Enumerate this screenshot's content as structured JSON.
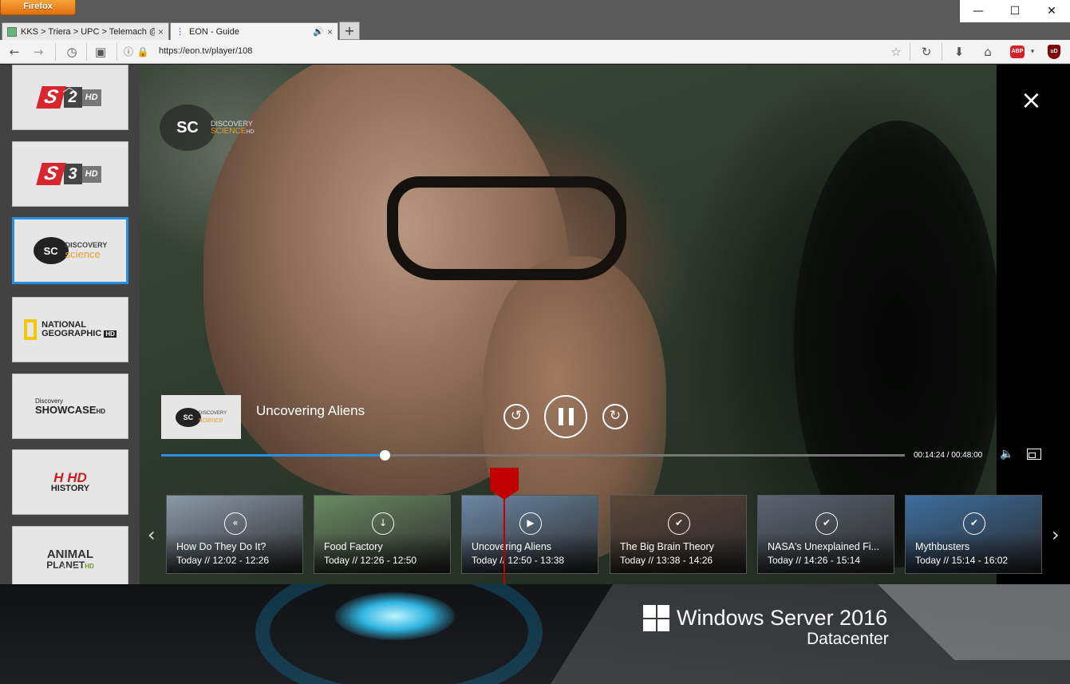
{
  "browser": {
    "app_button": "Firefox",
    "window_controls": {
      "minimize": "—",
      "maximize": "☐",
      "close": "✕"
    },
    "tabs": [
      {
        "label": "KKS > Triera > UPC > Telemach @ ...",
        "close": "×"
      },
      {
        "label": "EON - Guide",
        "sound": "🔊",
        "close": "×"
      }
    ],
    "new_tab": "+",
    "url": "https://eon.tv/player/108",
    "addons": {
      "adblock": "ABP",
      "ublock": "uD"
    }
  },
  "sidebar": {
    "channels": [
      {
        "name": "S2",
        "label_num": "2",
        "label_hd": "HD"
      },
      {
        "name": "S3",
        "label_num": "3",
        "label_hd": "HD"
      },
      {
        "name": "Discovery Science",
        "label_top": "DISCOVERY",
        "label_bottom": "science"
      },
      {
        "name": "National Geographic HD",
        "label_top": "NATIONAL",
        "label_bottom": "GEOGRAPHIC",
        "label_hd": "HD"
      },
      {
        "name": "Discovery Showcase HD",
        "label_top": "Discovery",
        "label_bottom": "SHOWCASE",
        "label_hd": "HD"
      },
      {
        "name": "History HD",
        "label_top": "H HD",
        "label_bottom": "HISTORY"
      },
      {
        "name": "Animal Planet HD",
        "label_top": "ANIMAL",
        "label_bottom": "PLANET",
        "label_hd": "HD"
      }
    ]
  },
  "player": {
    "watermark": {
      "badge": "SC",
      "line1": "DISCOVERY",
      "line2": "SCIENCE",
      "hd": "HD"
    },
    "now_playing": {
      "title": "Uncovering Aliens",
      "thumb_badge": "SC",
      "thumb_line1": "DISCOVERY",
      "thumb_line2": "science"
    },
    "controls": {
      "rewind": "↺",
      "forward": "↻",
      "volume_icon": "🔈",
      "close": "×"
    },
    "progress_fraction": 0.3,
    "timecode": "00:14:24 / 00:48:00"
  },
  "guide": {
    "programs": [
      {
        "title": "How Do They Do It?",
        "time": "Today // 12:02 - 12:26",
        "color": "#8a9aa8"
      },
      {
        "title": "Food Factory",
        "time": "Today // 12:26 - 12:50",
        "color": "#6a8a62"
      },
      {
        "title": "Uncovering Aliens",
        "time": "Today // 12:50 - 13:38",
        "color": "#6c87a3"
      },
      {
        "title": "The Big Brain Theory",
        "time": "Today // 13:38 - 14:26",
        "color": "#5a4638"
      },
      {
        "title": "NASA's Unexplained Fi...",
        "time": "Today // 14:26 - 15:14",
        "color": "#5b6470"
      },
      {
        "title": "Mythbusters",
        "time": "Today // 15:14 - 16:02",
        "color": "#3d6e9e"
      }
    ]
  },
  "desktop": {
    "os_title": "Windows Server 2016",
    "os_edition": "Datacenter"
  }
}
